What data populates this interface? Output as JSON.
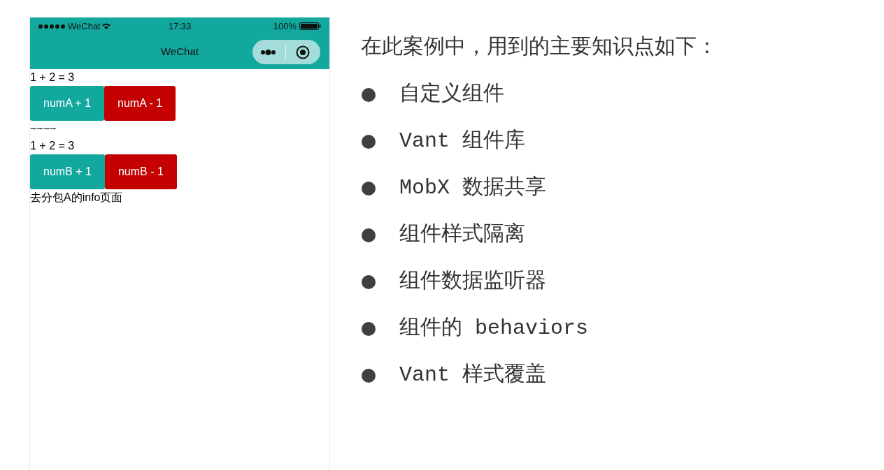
{
  "phone": {
    "status_bar": {
      "carrier": "WeChat",
      "time": "17:33",
      "battery": "100%"
    },
    "nav_bar": {
      "title": "WeChat"
    },
    "content": [
      {
        "kind": "text",
        "text": "1 + 2 = 3"
      },
      {
        "kind": "button_row",
        "buttons": [
          {
            "label": "numA + 1",
            "kind": "primary"
          },
          {
            "label": "numA - 1",
            "kind": "danger"
          }
        ]
      },
      {
        "kind": "text",
        "text": "~~~~"
      },
      {
        "kind": "text",
        "text": "1 + 2 = 3"
      },
      {
        "kind": "button_row",
        "buttons": [
          {
            "label": "numB + 1",
            "kind": "primary"
          },
          {
            "label": "numB - 1",
            "kind": "danger"
          }
        ]
      },
      {
        "kind": "text",
        "text": "去分包A的info页面"
      }
    ]
  },
  "slide": {
    "heading": "在此案例中，用到的主要知识点如下：",
    "bullets": [
      "自定义组件",
      "Vant 组件库",
      "MobX 数据共享",
      "组件样式隔离",
      "组件数据监听器",
      "组件的 behaviors",
      "Vant 样式覆盖"
    ]
  }
}
